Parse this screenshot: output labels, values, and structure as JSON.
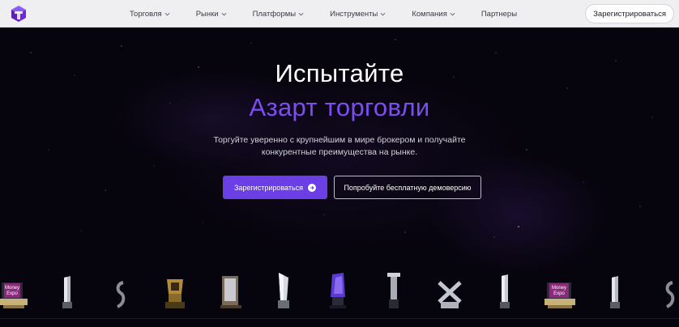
{
  "header": {
    "logo_icon": "brand-cube-icon",
    "nav": [
      {
        "label": "Торговля",
        "has_dropdown": true
      },
      {
        "label": "Рынки",
        "has_dropdown": true
      },
      {
        "label": "Платформы",
        "has_dropdown": true
      },
      {
        "label": "Инструменты",
        "has_dropdown": true
      },
      {
        "label": "Компания",
        "has_dropdown": true
      },
      {
        "label": "Партнеры",
        "has_dropdown": false
      }
    ],
    "register_label": "Зарегистрироваться"
  },
  "hero": {
    "title_line1": "Испытайте",
    "title_line2": "Азарт торговли",
    "subtitle": "Торгуйте уверенно с крупнейшим в мире брокером и получайте конкурентные преимущества на рынке.",
    "primary_button": "Зарегистрироваться",
    "secondary_button": "Попробуйте бесплатную демоверсию"
  },
  "awards": {
    "logo_text_1": "Money",
    "logo_text_2": "Expo"
  },
  "colors": {
    "accent": "#6a3fe6",
    "title_accent": "#7c4ef2",
    "background": "#06040c",
    "header_bg": "#efeff2"
  }
}
